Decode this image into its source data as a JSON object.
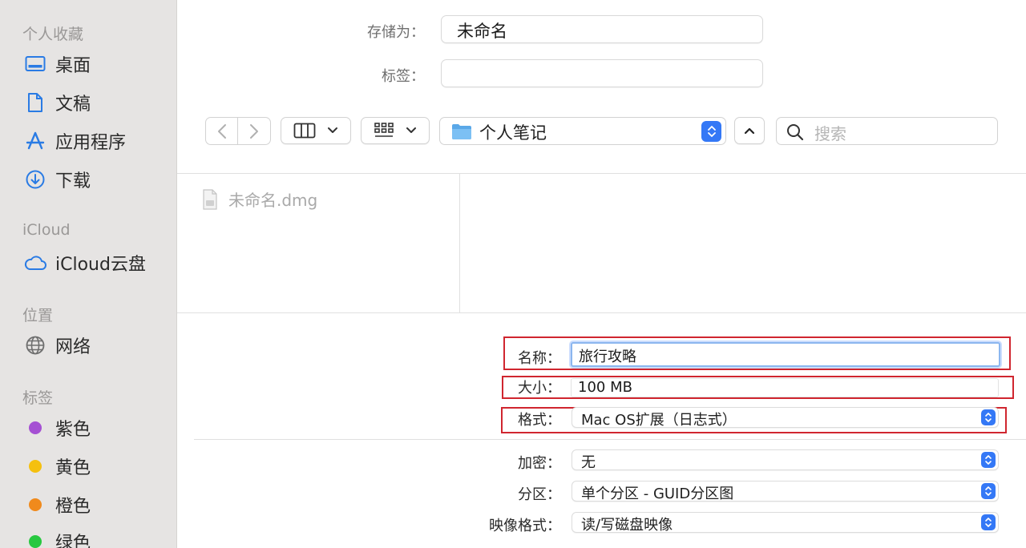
{
  "sidebar": {
    "favorites_header": "个人收藏",
    "favorites": [
      {
        "label": "桌面",
        "icon": "desktop-icon"
      },
      {
        "label": "文稿",
        "icon": "document-icon"
      },
      {
        "label": "应用程序",
        "icon": "applications-icon"
      },
      {
        "label": "下载",
        "icon": "download-icon"
      }
    ],
    "icloud_header": "iCloud",
    "icloud_items": [
      {
        "label": "iCloud云盘",
        "icon": "cloud-icon"
      }
    ],
    "locations_header": "位置",
    "locations": [
      {
        "label": "网络",
        "icon": "network-icon"
      }
    ],
    "tags_header": "标签",
    "tags": [
      {
        "label": "紫色",
        "color": "#a550d3"
      },
      {
        "label": "黄色",
        "color": "#f5c00f"
      },
      {
        "label": "橙色",
        "color": "#f08a1c"
      },
      {
        "label": "绿色",
        "color": "#28c840"
      }
    ]
  },
  "save": {
    "save_as_label": "存储为：",
    "save_as_value": "未命名",
    "tags_label": "标签：",
    "tags_value": ""
  },
  "toolbar": {
    "location": "个人笔记",
    "search_placeholder": "搜索"
  },
  "browser": {
    "files": [
      {
        "name": "未命名.dmg"
      }
    ]
  },
  "options": {
    "name_label": "名称：",
    "name_value": "旅行攻略",
    "size_label": "大小：",
    "size_value": "100 MB",
    "format_label": "格式：",
    "format_value": "Mac OS扩展（日志式）",
    "encryption_label": "加密：",
    "encryption_value": "无",
    "partition_label": "分区：",
    "partition_value": "单个分区 - GUID分区图",
    "image_format_label": "映像格式：",
    "image_format_value": "读/写磁盘映像"
  },
  "colors": {
    "accent": "#3478f6",
    "highlight_box": "#d0262f"
  }
}
